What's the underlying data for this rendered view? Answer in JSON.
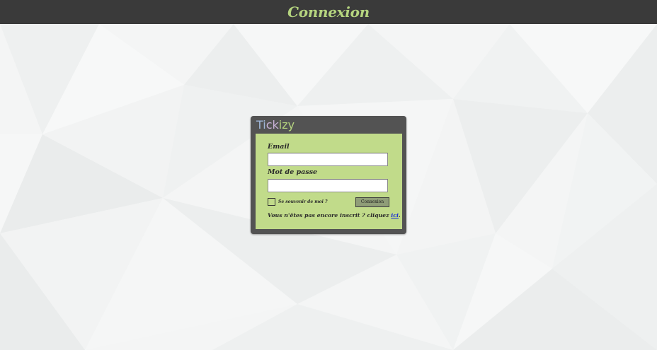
{
  "header": {
    "title": "Connexion"
  },
  "login_card": {
    "brand": {
      "part1": "Ti",
      "part2": "ck",
      "part3": "izy"
    },
    "email_label": "Email",
    "email_value": "",
    "password_label": "Mot de passe",
    "password_value": "",
    "remember_label": "Se souvenir de moi ?",
    "remember_checked": false,
    "submit_label": "Connexion",
    "signup_text": "Vous n'êtes pas encore inscrit ? cliquez ",
    "signup_link": "ici",
    "signup_suffix": "."
  },
  "colors": {
    "header_bg": "#3a3a3a",
    "accent_green": "#b5d47f",
    "panel_green": "#c1db8a",
    "card_bg": "#535353",
    "link_blue": "#1a2fd8"
  },
  "icons": {
    "background": "low-poly-pattern",
    "checkbox": "checkbox-icon"
  }
}
